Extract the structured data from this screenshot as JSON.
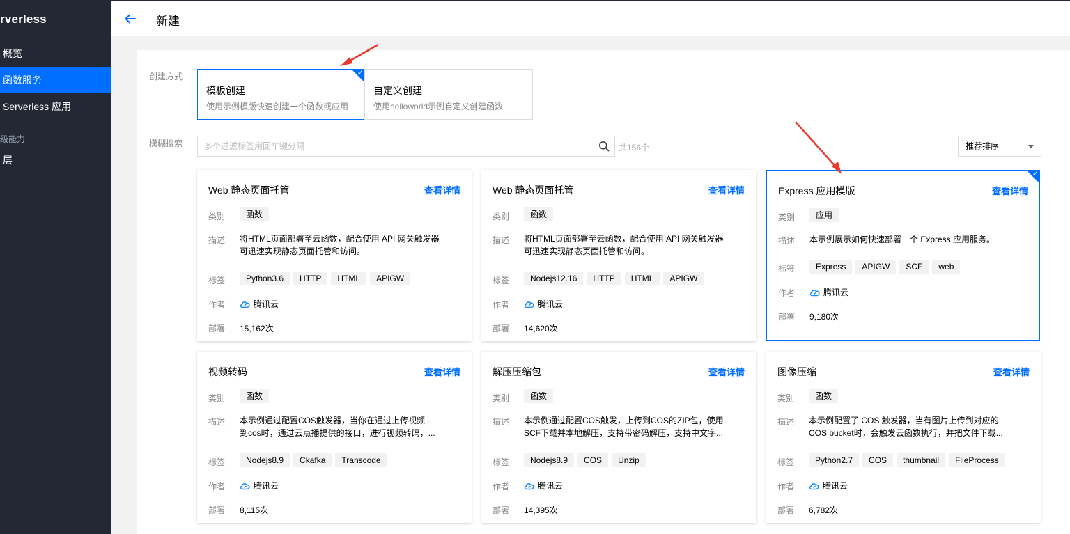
{
  "sidebar": {
    "title": "rverless",
    "items": [
      {
        "label": "概览",
        "active": false
      },
      {
        "label": "函数服务",
        "active": true
      },
      {
        "label": "Serverless 应用",
        "active": false
      }
    ],
    "section": "级能力",
    "section_items": [
      {
        "label": "层"
      }
    ]
  },
  "header": {
    "title": "新建"
  },
  "form": {
    "create_mode_label": "创建方式",
    "modes": [
      {
        "title": "模板创建",
        "desc": "使用示例模版快速创建一个函数或应用",
        "selected": true
      },
      {
        "title": "自定义创建",
        "desc": "使用helloworld示例自定义创建函数",
        "selected": false
      }
    ],
    "search_label": "模糊搜索",
    "search_placeholder": "多个过滤标签用回车键分隔",
    "total": "共156个",
    "sort": "推荐排序"
  },
  "card_labels": {
    "category": "类别",
    "desc": "描述",
    "tags": "标签",
    "author": "作者",
    "deploy": "部署",
    "detail": "查看详情"
  },
  "cards": [
    {
      "name": "Web 静态页面托管",
      "category": "函数",
      "desc": [
        "将HTML页面部署至云函数，配合使用 API 网关触发器",
        "可迅速实现静态页面托管和访问。"
      ],
      "tags": [
        "Python3.6",
        "HTTP",
        "HTML",
        "APIGW"
      ],
      "author": "腾讯云",
      "deploys": "15,162次",
      "selected": false
    },
    {
      "name": "Web 静态页面托管",
      "category": "函数",
      "desc": [
        "将HTML页面部署至云函数，配合使用 API 网关触发器",
        "可迅速实现静态页面托管和访问。"
      ],
      "tags": [
        "Nodejs12.16",
        "HTTP",
        "HTML",
        "APIGW"
      ],
      "author": "腾讯云",
      "deploys": "14,620次",
      "selected": false
    },
    {
      "name": "Express 应用模版",
      "category": "应用",
      "desc": [
        "本示例展示如何快速部署一个 Express 应用服务。"
      ],
      "tags": [
        "Express",
        "APIGW",
        "SCF",
        "web"
      ],
      "author": "腾讯云",
      "deploys": "9,180次",
      "selected": true
    },
    {
      "name": "视频转码",
      "category": "函数",
      "desc": [
        "本示例通过配置COS触发器，当你在通过上传视频...",
        "到cos时，通过云点播提供的接口，进行视频转码，..."
      ],
      "tags": [
        "Nodejs8.9",
        "Ckafka",
        "Transcode"
      ],
      "author": "腾讯云",
      "deploys": "8,115次",
      "selected": false
    },
    {
      "name": "解压压缩包",
      "category": "函数",
      "desc": [
        "本示例通过配置COS触发，上传到COS的ZIP包，使用",
        "SCF下载并本地解压，支持带密码解压，支持中文字..."
      ],
      "tags": [
        "Nodejs8.9",
        "COS",
        "Unzip"
      ],
      "author": "腾讯云",
      "deploys": "14,395次",
      "selected": false
    },
    {
      "name": "图像压缩",
      "category": "函数",
      "desc": [
        "本示例配置了 COS 触发器，当有图片上传到对应的",
        "COS bucket时，会触发云函数执行，并把文件下载..."
      ],
      "tags": [
        "Python2.7",
        "COS",
        "thumbnail",
        "FileProcess"
      ],
      "author": "腾讯云",
      "deploys": "6,782次",
      "selected": false
    }
  ],
  "colors": {
    "sidebar_bg": "#232834",
    "accent": "#006eff",
    "annotation_arrow": "#e8392c"
  }
}
